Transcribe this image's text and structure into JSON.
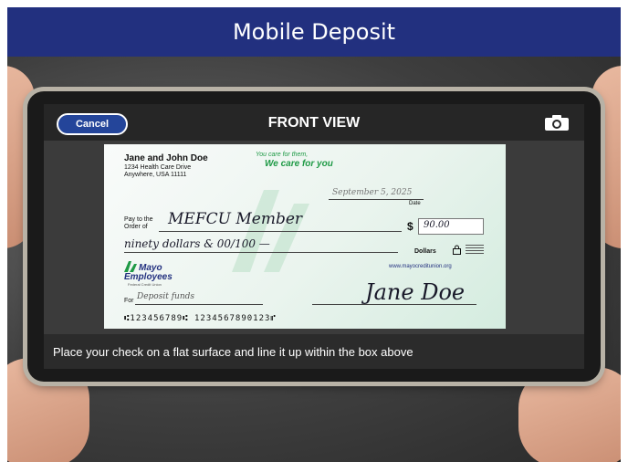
{
  "header": {
    "title": "Mobile Deposit"
  },
  "screen": {
    "cancel_label": "Cancel",
    "view_title": "FRONT VIEW",
    "instruction": "Place your check on a flat surface and line it up within the box above"
  },
  "check": {
    "owner_name": "Jane and John Doe",
    "address_line1": "1234 Health Care Drive",
    "address_line2": "Anywhere, USA 11111",
    "tagline_small": "You care for them,",
    "tagline_big": "We care for you",
    "date_value": "September 5, 2025",
    "date_label": "Date",
    "pay_to_label1": "Pay to the",
    "pay_to_label2": "Order of",
    "payee": "MEFCU Member",
    "dollar_sign": "$",
    "amount": "90.00",
    "written_amount": "ninety dollars & 00/100 —",
    "dollars_label": "Dollars",
    "website": "www.mayocreditunion.org",
    "bank_name1": "Mayo",
    "bank_name2": "Employees",
    "bank_name3": "Federal Credit Union",
    "memo_label": "For",
    "memo_value": "Deposit funds",
    "signature": "Jane Doe",
    "micr": "⑆123456789⑆ 1234567890123⑈"
  },
  "colors": {
    "header_bg": "#22307f",
    "cancel_bg": "#24459a",
    "tagline": "#1f9a46"
  }
}
